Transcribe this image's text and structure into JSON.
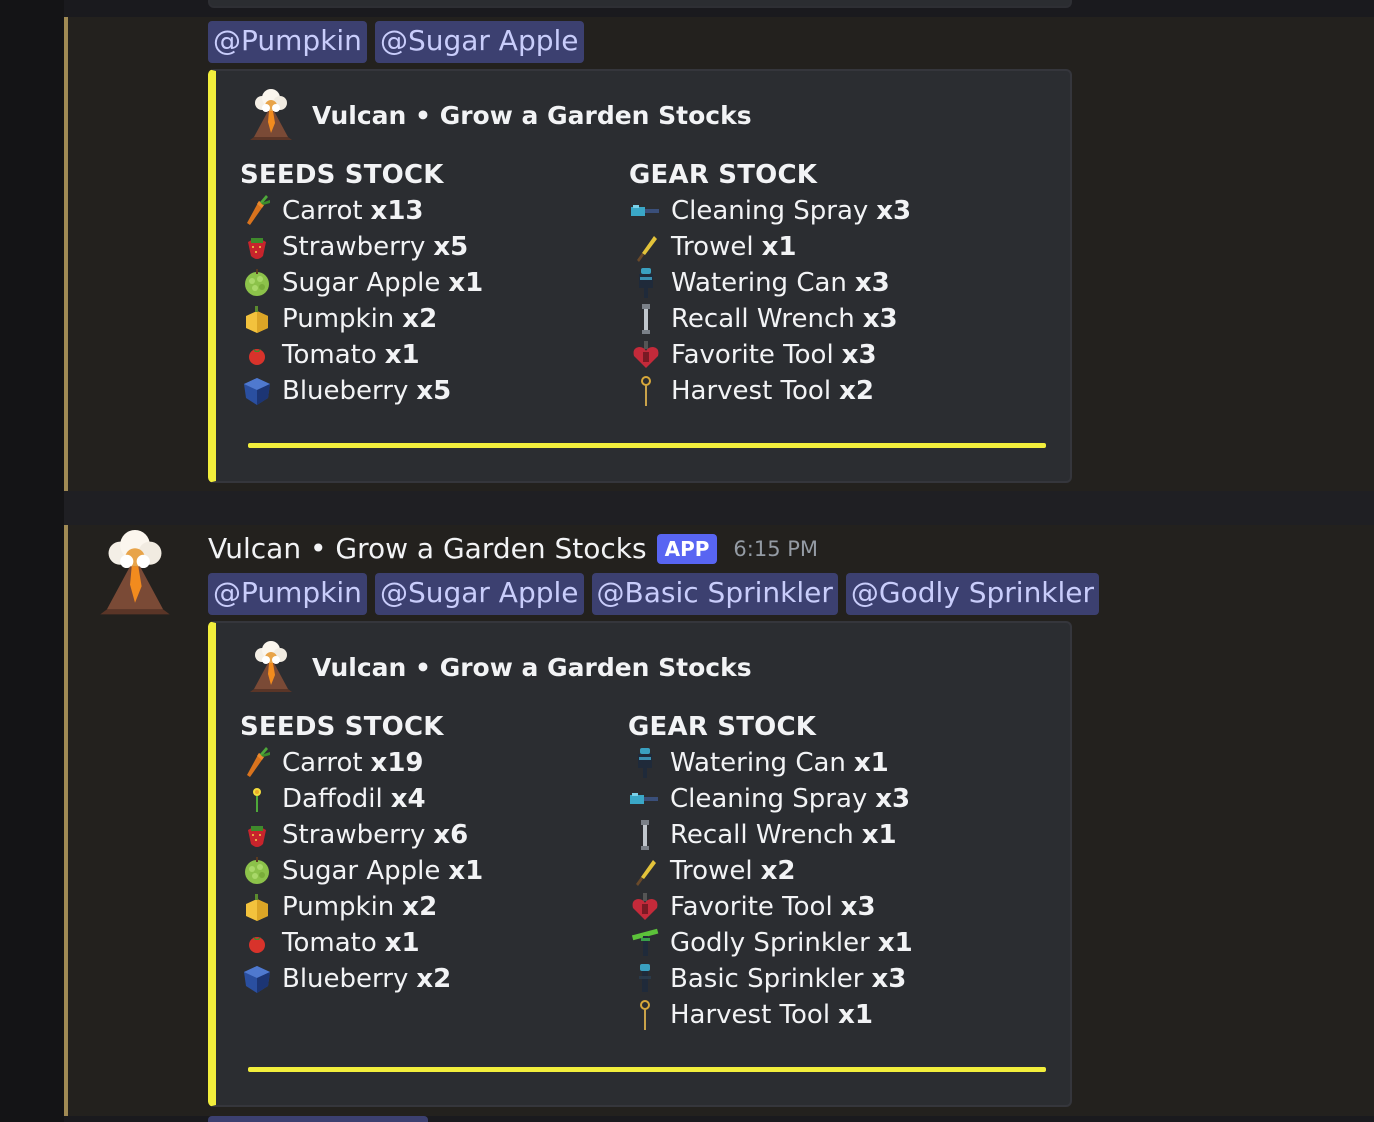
{
  "colors": {
    "embed_accent": "#f2ee3c",
    "mention_bg": "#3c4070",
    "app_badge": "#5865f2",
    "highlight_bar": "#a08a54"
  },
  "messages": [
    {
      "mentions": [
        "@Pumpkin",
        "@Sugar Apple"
      ],
      "embed": {
        "author": "Vulcan • Grow a Garden Stocks",
        "author_icon": "volcano-icon",
        "seeds_title": "SEEDS STOCK",
        "gear_title": "GEAR STOCK",
        "seeds": [
          {
            "name": "Carrot",
            "qty": "x13",
            "icon": "carrot-icon"
          },
          {
            "name": "Strawberry",
            "qty": "x5",
            "icon": "strawberry-icon"
          },
          {
            "name": "Sugar Apple",
            "qty": "x1",
            "icon": "sugar-apple-icon"
          },
          {
            "name": "Pumpkin",
            "qty": "x2",
            "icon": "pumpkin-icon"
          },
          {
            "name": "Tomato",
            "qty": "x1",
            "icon": "tomato-icon"
          },
          {
            "name": "Blueberry",
            "qty": "x5",
            "icon": "blueberry-icon"
          }
        ],
        "gear": [
          {
            "name": "Cleaning Spray",
            "qty": "x3",
            "icon": "cleaning-spray-icon"
          },
          {
            "name": "Trowel",
            "qty": "x1",
            "icon": "trowel-icon"
          },
          {
            "name": "Watering Can",
            "qty": "x3",
            "icon": "watering-can-icon"
          },
          {
            "name": "Recall Wrench",
            "qty": "x3",
            "icon": "recall-wrench-icon"
          },
          {
            "name": "Favorite Tool",
            "qty": "x3",
            "icon": "favorite-tool-icon"
          },
          {
            "name": "Harvest Tool",
            "qty": "x2",
            "icon": "harvest-tool-icon"
          }
        ]
      }
    },
    {
      "username": "Vulcan • Grow a Garden Stocks",
      "badge": "APP",
      "timestamp": "6:15 PM",
      "avatar_icon": "volcano-icon",
      "mentions": [
        "@Pumpkin",
        "@Sugar Apple",
        "@Basic Sprinkler",
        "@Godly Sprinkler"
      ],
      "embed": {
        "author": "Vulcan • Grow a Garden Stocks",
        "author_icon": "volcano-icon",
        "seeds_title": "SEEDS STOCK",
        "gear_title": "GEAR STOCK",
        "seeds": [
          {
            "name": "Carrot",
            "qty": "x19",
            "icon": "carrot-icon"
          },
          {
            "name": "Daffodil",
            "qty": "x4",
            "icon": "daffodil-icon"
          },
          {
            "name": "Strawberry",
            "qty": "x6",
            "icon": "strawberry-icon"
          },
          {
            "name": "Sugar Apple",
            "qty": "x1",
            "icon": "sugar-apple-icon"
          },
          {
            "name": "Pumpkin",
            "qty": "x2",
            "icon": "pumpkin-icon"
          },
          {
            "name": "Tomato",
            "qty": "x1",
            "icon": "tomato-icon"
          },
          {
            "name": "Blueberry",
            "qty": "x2",
            "icon": "blueberry-icon"
          }
        ],
        "gear": [
          {
            "name": "Watering Can",
            "qty": "x1",
            "icon": "watering-can-icon"
          },
          {
            "name": "Cleaning Spray",
            "qty": "x3",
            "icon": "cleaning-spray-icon"
          },
          {
            "name": "Recall Wrench",
            "qty": "x1",
            "icon": "recall-wrench-icon"
          },
          {
            "name": "Trowel",
            "qty": "x2",
            "icon": "trowel-icon"
          },
          {
            "name": "Favorite Tool",
            "qty": "x3",
            "icon": "favorite-tool-icon"
          },
          {
            "name": "Godly Sprinkler",
            "qty": "x1",
            "icon": "godly-sprinkler-icon"
          },
          {
            "name": "Basic Sprinkler",
            "qty": "x3",
            "icon": "basic-sprinkler-icon"
          },
          {
            "name": "Harvest Tool",
            "qty": "x1",
            "icon": "harvest-tool-icon"
          }
        ]
      }
    }
  ]
}
